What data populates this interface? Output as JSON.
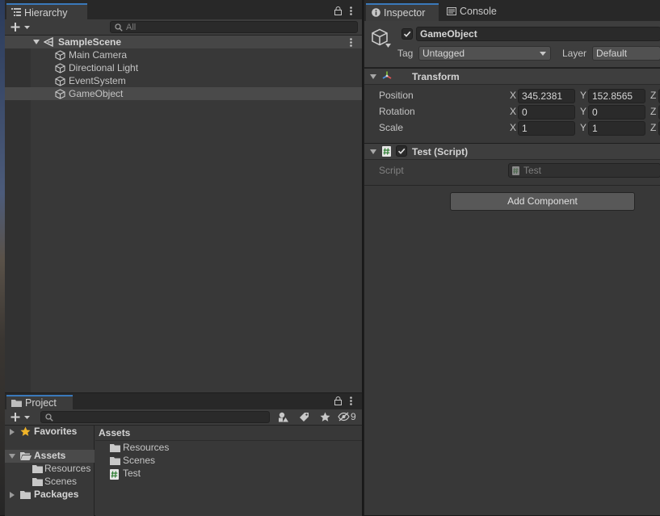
{
  "hierarchy": {
    "tab_title": "Hierarchy",
    "search_placeholder": "All",
    "scene_name": "SampleScene",
    "items": [
      "Main Camera",
      "Directional Light",
      "EventSystem",
      "GameObject"
    ],
    "selected_item": "GameObject"
  },
  "project": {
    "tab_title": "Project",
    "hidden_packages_count": "9",
    "favorites_label": "Favorites",
    "assets_label": "Assets",
    "packages_label": "Packages",
    "asset_tree_children": [
      "Resources",
      "Scenes"
    ],
    "breadcrumb": "Assets",
    "assets": [
      {
        "name": "Resources",
        "icon": "folder-icon"
      },
      {
        "name": "Scenes",
        "icon": "folder-icon"
      },
      {
        "name": "Test",
        "icon": "csharp-script-icon"
      }
    ]
  },
  "inspector": {
    "tab_title": "Inspector",
    "console_tab_title": "Console",
    "object_name": "GameObject",
    "active": true,
    "tag_label": "Tag",
    "tag_value": "Untagged",
    "layer_label": "Layer",
    "layer_value": "Default",
    "transform": {
      "title": "Transform",
      "position_label": "Position",
      "rotation_label": "Rotation",
      "scale_label": "Scale",
      "x_axis": "X",
      "y_axis": "Y",
      "z_axis": "Z",
      "position": {
        "x": "345.2381",
        "y": "152.8565"
      },
      "rotation": {
        "x": "0",
        "y": "0"
      },
      "scale": {
        "x": "1",
        "y": "1"
      }
    },
    "script_component": {
      "title": "Test (Script)",
      "enabled": true,
      "script_label": "Script",
      "script_value": "Test"
    },
    "add_component_label": "Add Component"
  },
  "colors": {
    "accent": "#3a79bb",
    "panel_bg": "#383838",
    "selected_row": "#4a4a4a"
  }
}
